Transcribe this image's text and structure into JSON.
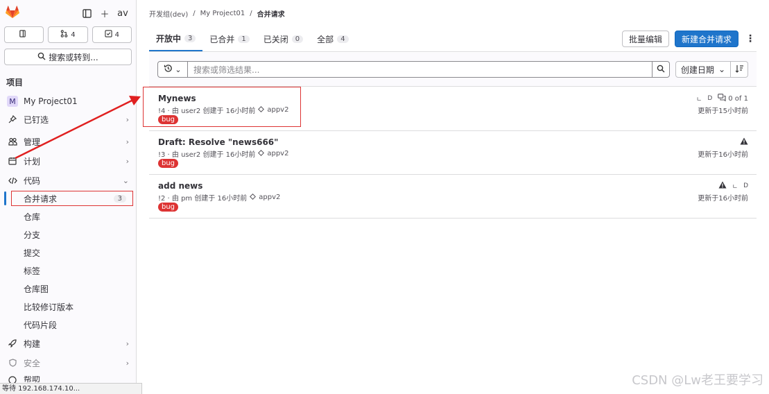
{
  "sidebar": {
    "user_initials": "av",
    "counts": [
      {
        "icon": "todo-icon",
        "count": ""
      },
      {
        "icon": "merge-request-icon",
        "count": "4"
      },
      {
        "icon": "review-icon",
        "count": "4"
      }
    ],
    "search_label": "搜索或转到...",
    "section_heading": "项目",
    "project_initial": "M",
    "project_name": "My Project01",
    "items": {
      "pinned": "已钉选",
      "manage": "管理",
      "plan": "计划",
      "code": "代码",
      "build": "构建",
      "secure": "安全",
      "help": "帮助"
    },
    "code_sub": {
      "merge_requests": "合并请求",
      "merge_requests_count": "3",
      "repository": "仓库",
      "branches": "分支",
      "commits": "提交",
      "tags": "标签",
      "graph": "仓库图",
      "compare": "比较修订版本",
      "snippets": "代码片段"
    },
    "status_text": "等待 192.168.174.10..."
  },
  "breadcrumb": {
    "group": "开发组(dev)",
    "project": "My Project01",
    "current": "合并请求"
  },
  "tabs": [
    {
      "label": "开放中",
      "count": "3"
    },
    {
      "label": "已合并",
      "count": "1"
    },
    {
      "label": "已关闭",
      "count": "0"
    },
    {
      "label": "全部",
      "count": "4"
    }
  ],
  "actions": {
    "bulk_edit": "批量编辑",
    "new_mr": "新建合并请求"
  },
  "filter": {
    "placeholder": "搜索或筛选结果...",
    "sort_label": "创建日期"
  },
  "merge_requests": [
    {
      "title": "Mynews",
      "ref": "!4 · 由 user2 创建于 16小时前",
      "milestone": "appv2",
      "label": "bug",
      "comments": "0 of 1",
      "updated": "更新于15小时前"
    },
    {
      "title": "Draft: Resolve \"news666\"",
      "ref": "!3 · 由 user2 创建于 16小时前",
      "milestone": "appv2",
      "label": "bug",
      "updated": "更新于16小时前"
    },
    {
      "title": "add news",
      "ref": "!2 · 由 pm 创建于 16小时前",
      "milestone": "appv2",
      "label": "bug",
      "updated": "更新于16小时前"
    }
  ],
  "watermark": "CSDN @Lw老王要学习",
  "colors": {
    "accent": "#1f75cb",
    "label_bug": "#dd3333",
    "annotation": "#dd3333"
  }
}
